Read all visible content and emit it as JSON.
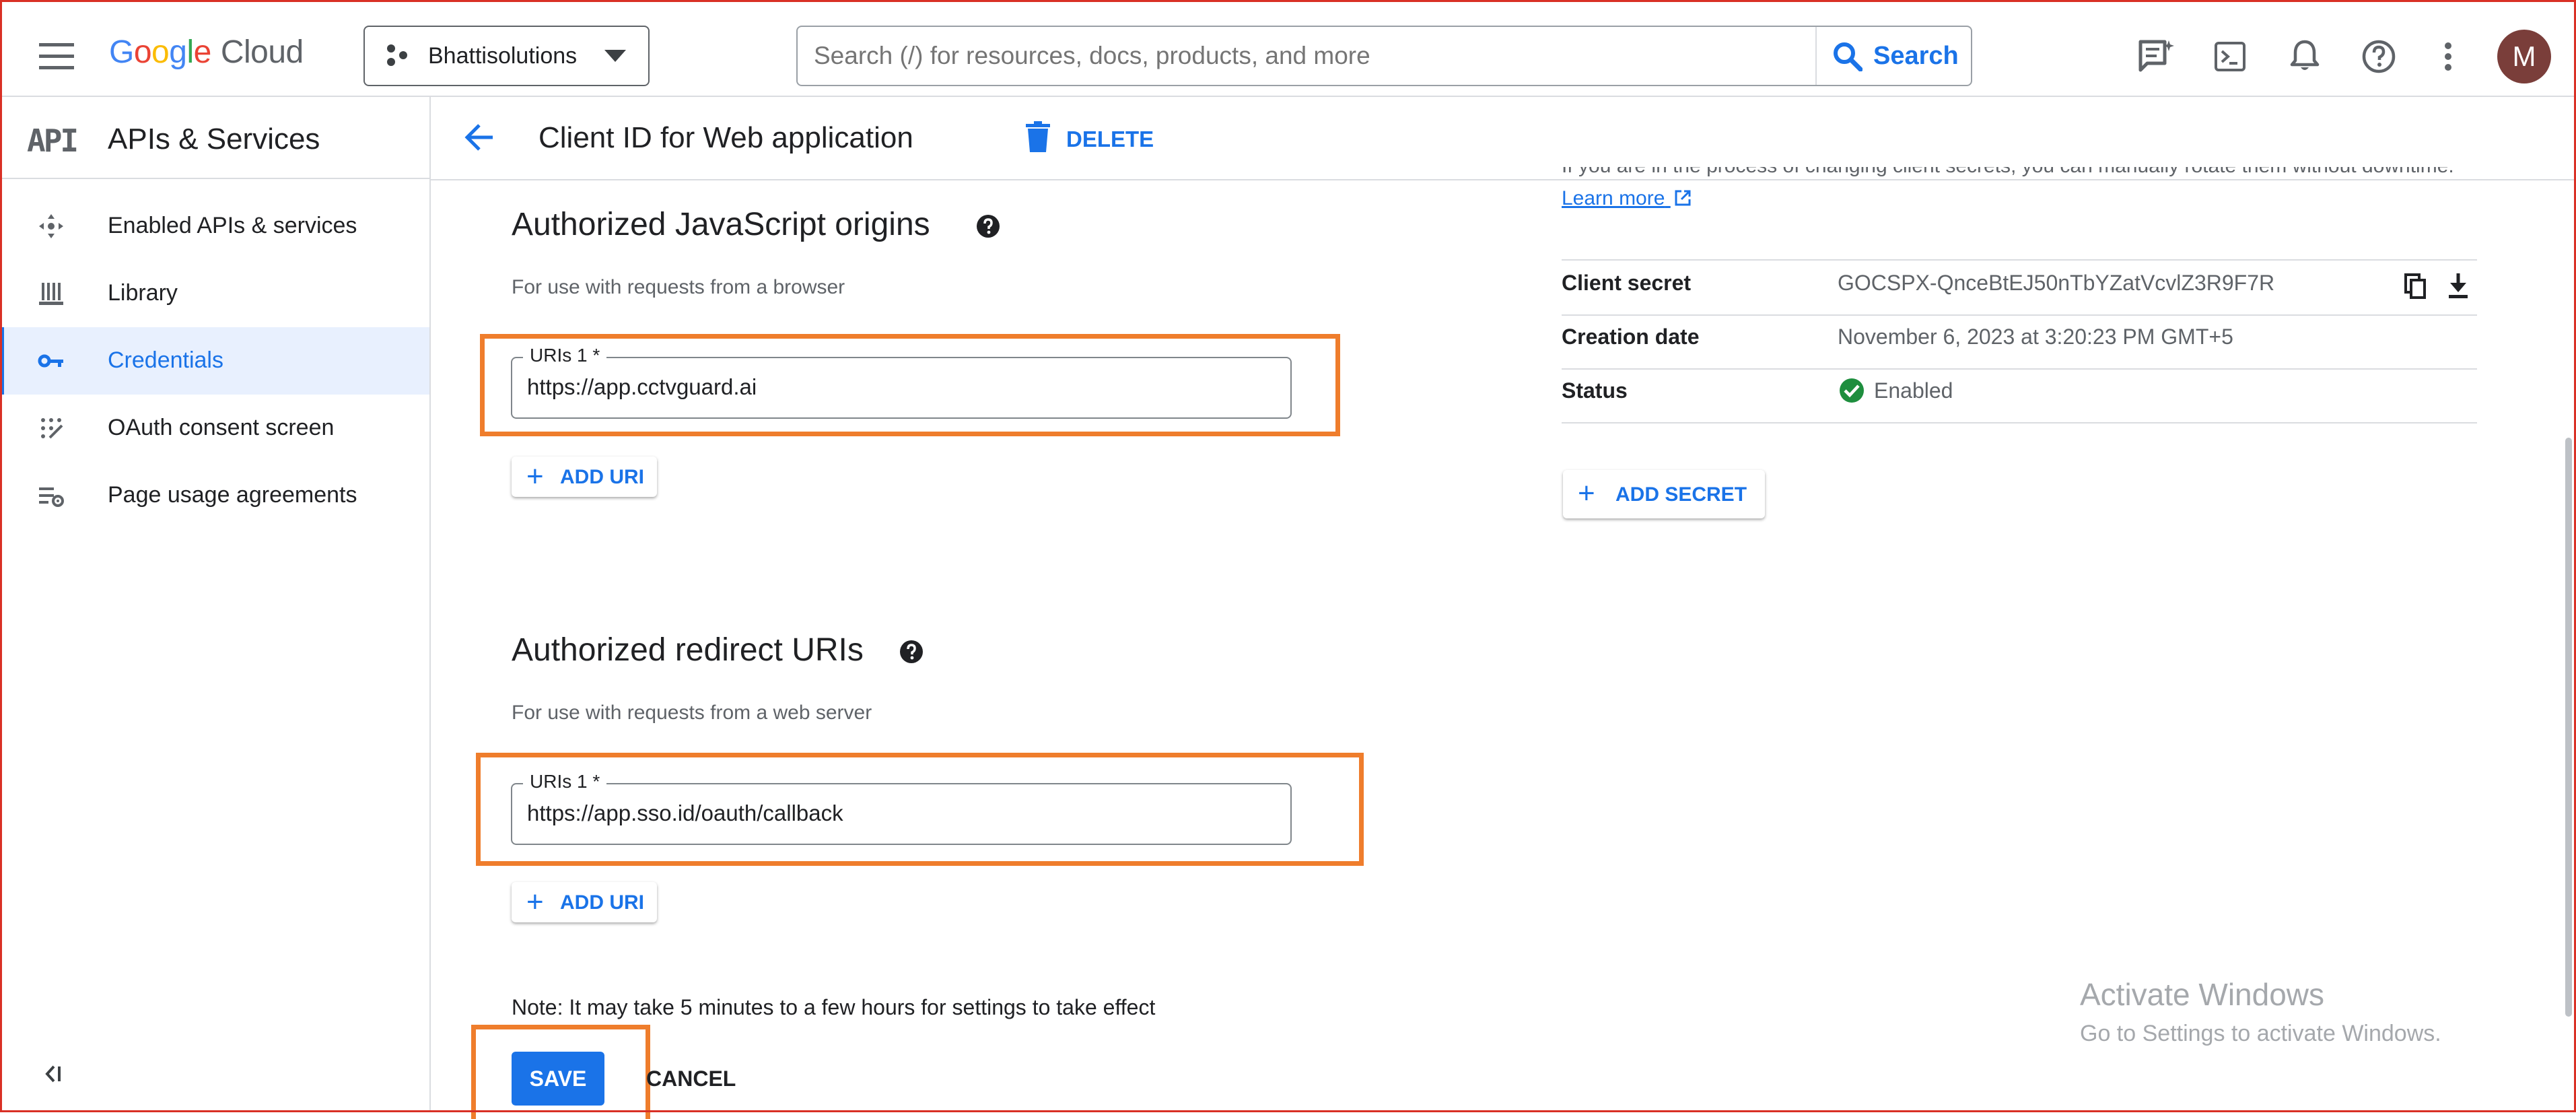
{
  "header": {
    "logo": {
      "google": [
        "G",
        "o",
        "o",
        "g",
        "l",
        "e"
      ],
      "google_colors": [
        "#4285F4",
        "#EA4335",
        "#FBBC05",
        "#4285F4",
        "#34A853",
        "#EA4335"
      ],
      "cloud": "Cloud"
    },
    "project": "Bhattisolutions",
    "search_placeholder": "Search (/) for resources, docs, products, and more",
    "search_button": "Search",
    "avatar_letter": "M"
  },
  "sidebar": {
    "title": "APIs & Services",
    "api_badge": "API",
    "items": [
      {
        "label": "Enabled APIs & services"
      },
      {
        "label": "Library"
      },
      {
        "label": "Credentials"
      },
      {
        "label": "OAuth consent screen"
      },
      {
        "label": "Page usage agreements"
      }
    ],
    "active": 2
  },
  "page": {
    "title": "Client ID for Web application",
    "delete_label": "DELETE"
  },
  "js_origins": {
    "heading": "Authorized JavaScript origins",
    "description": "For use with requests from a browser",
    "field_label": "URIs 1 *",
    "field_value": "https://app.cctvguard.ai",
    "add_label": "ADD URI"
  },
  "redirects": {
    "heading": "Authorized redirect URIs",
    "description": "For use with requests from a web server",
    "field_label": "URIs 1 *",
    "field_value": "https://app.sso.id/oauth/callback",
    "add_label": "ADD URI"
  },
  "note": "Note: It may take 5 minutes to a few hours for settings to take effect",
  "actions": {
    "save": "SAVE",
    "cancel": "CANCEL"
  },
  "secret_panel": {
    "partial_text": "If you are in the process of changing client secrets, you can manually rotate them without downtime.",
    "learn_more": "Learn more",
    "rows": [
      {
        "label": "Client secret",
        "value": "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"
      },
      {
        "label": "Creation date",
        "value": "November 6, 2023 at 3:20:23 PM GMT+5"
      },
      {
        "label": "Status",
        "value": "Enabled"
      }
    ],
    "add_secret": "ADD SECRET"
  },
  "watermark": {
    "line1": "Activate Windows",
    "line2": "Go to Settings to activate Windows."
  },
  "colors": {
    "accent": "#1a73e8",
    "highlight": "#ef7d2c",
    "success": "#1e8e3e"
  }
}
